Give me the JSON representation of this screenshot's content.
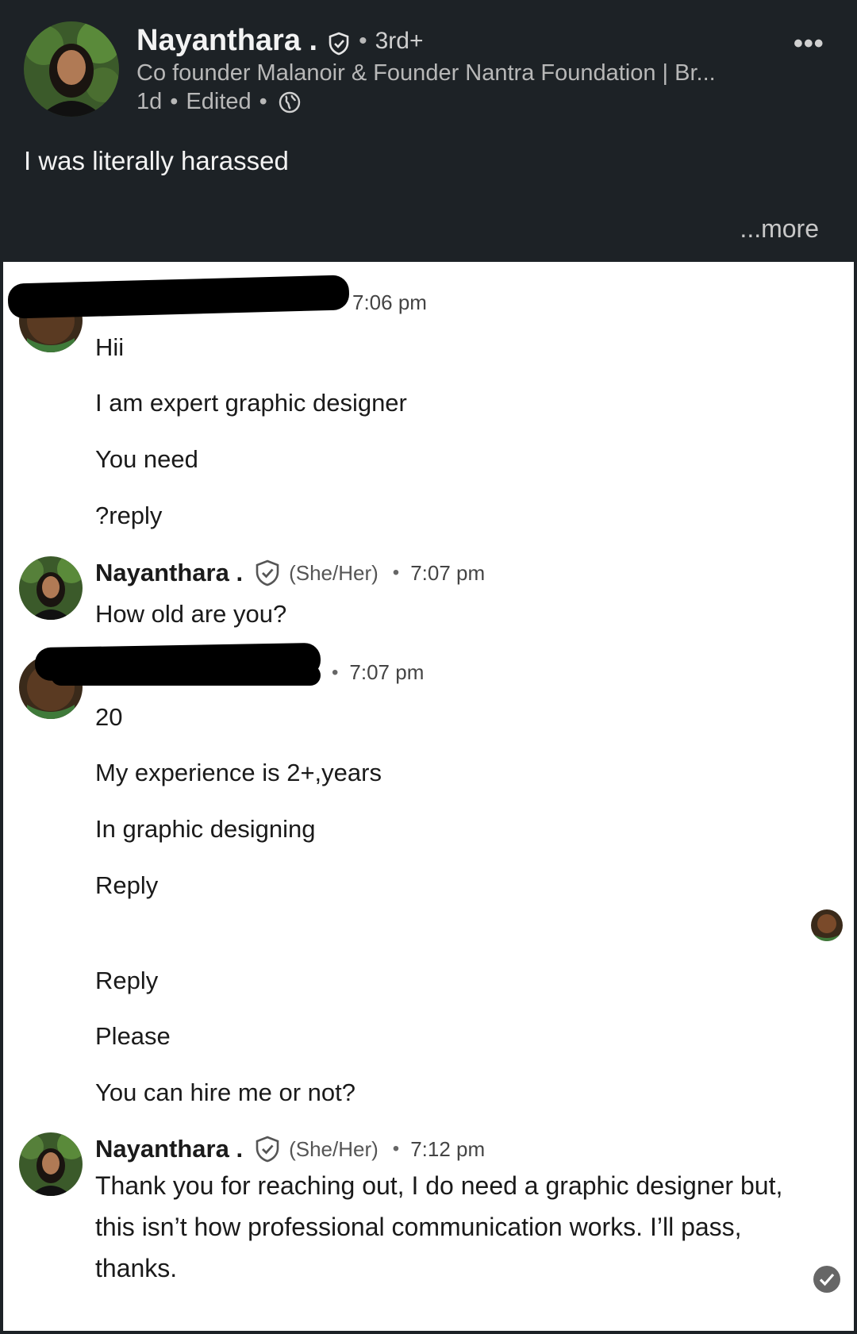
{
  "post": {
    "author_name": "Nayanthara .",
    "degree": "3rd+",
    "headline": "Co founder Malanoir & Founder Nantra Foundation | Br...",
    "time": "1d",
    "edited": "Edited",
    "text": "I was literally harassed",
    "see_more": "...more",
    "menu_dots": "•••"
  },
  "chat": {
    "messages": [
      {
        "sender": "",
        "time": "7:06 pm",
        "lines": [
          "Hii",
          "I am expert graphic designer",
          "You need",
          "?reply"
        ]
      },
      {
        "sender": "Nayanthara .",
        "pronouns": "(She/Her)",
        "time": "7:07 pm",
        "lines": [
          "How old are you?"
        ]
      },
      {
        "sender": "",
        "time": "7:07 pm",
        "lines": [
          "20",
          "My experience is 2+,years",
          "In graphic designing",
          "Reply",
          "Reply",
          "Please",
          "You can hire me or not?"
        ]
      },
      {
        "sender": "Nayanthara .",
        "pronouns": "(She/Her)",
        "time": "7:12 pm",
        "text": "Thank you for reaching out, I do need a graphic designer but, this isn’t how professional communication works. I’ll pass, thanks."
      }
    ]
  },
  "icons": {
    "verified": "shield-check-icon",
    "globe": "globe-icon",
    "more": "more-dots-icon",
    "read_check": "check-circle-icon"
  },
  "colors": {
    "header_bg": "#1d2226",
    "text_dark": "#1a1a1a",
    "muted": "#b8b8b8"
  }
}
